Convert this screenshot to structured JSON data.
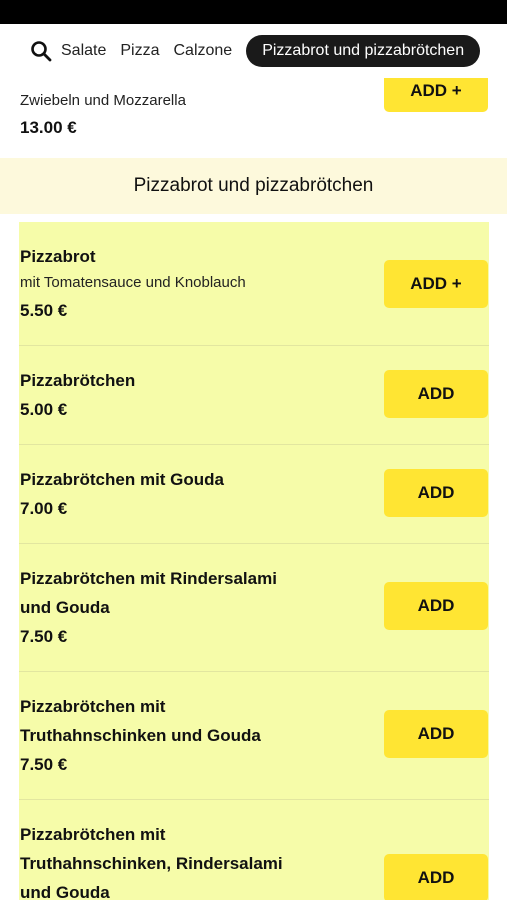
{
  "nav": {
    "search_icon": "search-icon",
    "tabs": [
      "Salate",
      "Pizza",
      "Calzone"
    ],
    "active_tab": "Pizzabrot und pizzabrötchen"
  },
  "previous_item": {
    "description": "Zwiebeln und Mozzarella",
    "price": "13.00 €",
    "add_label": "ADD +"
  },
  "section": {
    "title": "Pizzabrot und pizzabrötchen"
  },
  "items": [
    {
      "name": "Pizzabrot",
      "description": "mit Tomatensauce und Knoblauch",
      "price": "5.50 €",
      "add_label": "ADD +"
    },
    {
      "name": "Pizzabrötchen",
      "price": "5.00 €",
      "add_label": "ADD"
    },
    {
      "name": "Pizzabrötchen mit Gouda",
      "price": "7.00 €",
      "add_label": "ADD"
    },
    {
      "name_line1": "Pizzabrötchen mit Rindersalami",
      "name_line2": "und Gouda",
      "price": "7.50 €",
      "add_label": "ADD"
    },
    {
      "name_line1": "Pizzabrötchen mit",
      "name_line2": "Truthahnschinken und Gouda",
      "price": "7.50 €",
      "add_label": "ADD"
    },
    {
      "name_line1": "Pizzabrötchen mit",
      "name_line2": "Truthahnschinken, Rindersalami",
      "name_line3": "und Gouda",
      "add_label": "ADD"
    }
  ],
  "colors": {
    "accent_button": "#ffe533",
    "item_background": "#f6fca9",
    "section_header_background": "#fdf9dc",
    "active_tab_background": "#1a1a1a"
  }
}
